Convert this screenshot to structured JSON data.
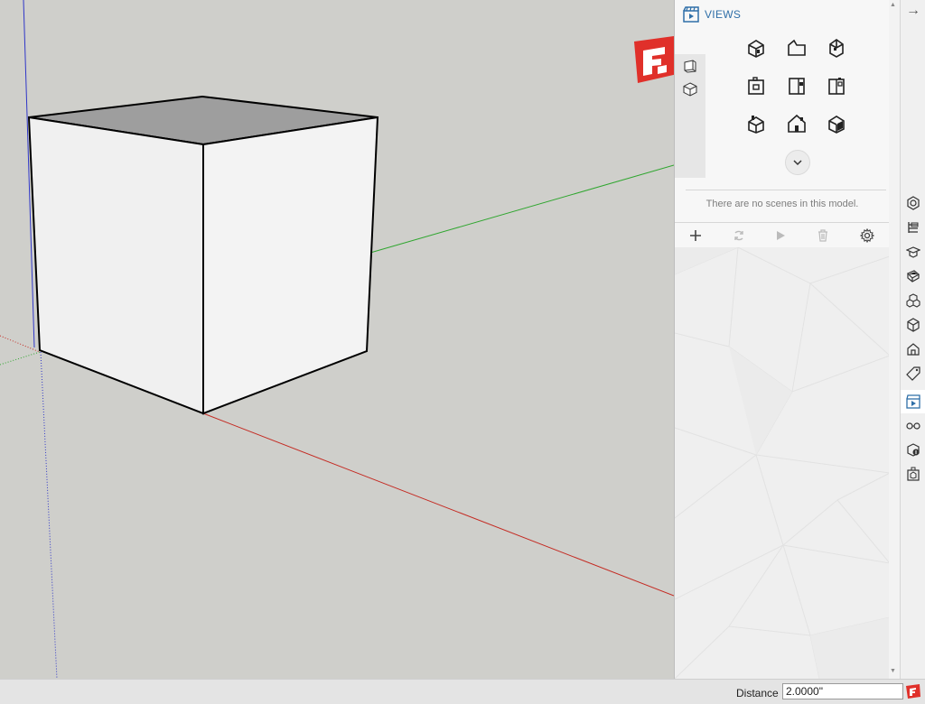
{
  "viewport": {
    "axes": {
      "red": "#c42a22",
      "green": "#2fa62f",
      "blue": "#2f36c8"
    },
    "cube": {
      "top_color": "#9e9e9e",
      "face_color": "#f0f0f0",
      "edge_color": "#000000"
    }
  },
  "panel": {
    "title": "VIEWS",
    "title_icon": "scenes-clapper-icon",
    "side_tabs": [
      {
        "name": "view-tab-standard",
        "icon": "cube-outline-icon"
      },
      {
        "name": "view-tab-iso",
        "icon": "iso-cube-icon"
      }
    ],
    "view_buttons": [
      {
        "name": "iso-view-button",
        "icon": "iso-house-icon"
      },
      {
        "name": "top-view-button",
        "icon": "top-house-icon"
      },
      {
        "name": "front-view-button",
        "icon": "front-house-icon"
      },
      {
        "name": "right-view-button",
        "icon": "right-house-icon"
      },
      {
        "name": "back-view-button",
        "icon": "back-house-icon"
      },
      {
        "name": "left-view-button",
        "icon": "left-house-icon"
      },
      {
        "name": "bottom-view-button",
        "icon": "bottom-house-icon"
      },
      {
        "name": "perspective-button",
        "icon": "perspective-house-icon"
      },
      {
        "name": "parallel-button",
        "icon": "parallel-house-icon"
      }
    ],
    "expand_icon": "chevron-down-icon",
    "no_scenes_text": "There are no scenes in this model.",
    "toolbar_icons": [
      "plus-icon",
      "refresh-icon",
      "play-icon",
      "trash-icon",
      "gear-icon"
    ]
  },
  "tray": {
    "collapse_icon": "arrow-right-icon",
    "icons": [
      "styles-icon",
      "outliner-icon",
      "instructor-icon",
      "materials-icon",
      "components-icon",
      "entity-info-icon",
      "3d-warehouse-icon",
      "tags-icon",
      "scenes-icon",
      "display-icon",
      "model-info-icon",
      "solid-tools-icon"
    ],
    "active": "scenes-icon"
  },
  "statusbar": {
    "vcb_label": "Distance",
    "vcb_value": "2.0000\"",
    "logo_icon": "sketchup-logo-icon"
  },
  "colors": {
    "accent": "#2f6fa8",
    "logo_red": "#e0302a"
  }
}
